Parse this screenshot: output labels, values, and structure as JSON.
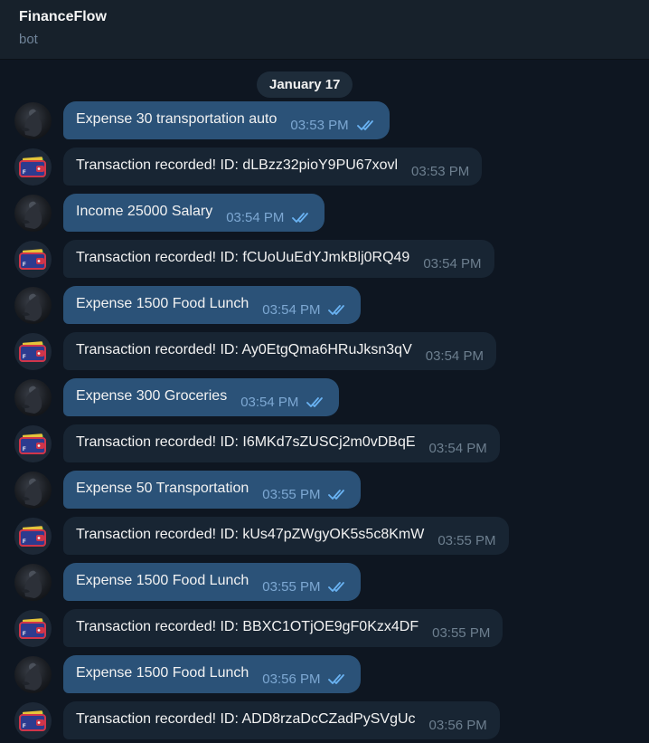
{
  "chat": {
    "title": "FinanceFlow",
    "subtitle": "bot"
  },
  "date_separator": "January 17",
  "icons": {
    "user_avatar": "user-avatar-icon",
    "bot_avatar": "wallet-icon",
    "read_status": "double-check-icon"
  },
  "colors": {
    "outgoing_bubble": "#2b5278",
    "incoming_bubble": "#182533",
    "background": "#0e1621",
    "check_color": "#6ab3f3"
  },
  "messages": [
    {
      "direction": "out",
      "text": "Expense 30 transportation auto",
      "time": "03:53 PM"
    },
    {
      "direction": "in",
      "text": "Transaction recorded! ID: dLBzz32pioY9PU67xovl",
      "time": "03:53 PM"
    },
    {
      "direction": "out",
      "text": "Income 25000 Salary",
      "time": "03:54 PM"
    },
    {
      "direction": "in",
      "text": "Transaction recorded! ID: fCUoUuEdYJmkBlj0RQ49",
      "time": "03:54 PM"
    },
    {
      "direction": "out",
      "text": "Expense 1500 Food Lunch",
      "time": "03:54 PM"
    },
    {
      "direction": "in",
      "text": "Transaction recorded! ID: Ay0EtgQma6HRuJksn3qV",
      "time": "03:54 PM"
    },
    {
      "direction": "out",
      "text": "Expense 300 Groceries",
      "time": "03:54 PM"
    },
    {
      "direction": "in",
      "text": "Transaction recorded! ID: I6MKd7sZUSCj2m0vDBqE",
      "time": "03:54 PM"
    },
    {
      "direction": "out",
      "text": "Expense 50 Transportation",
      "time": "03:55 PM"
    },
    {
      "direction": "in",
      "text": "Transaction recorded! ID: kUs47pZWgyOK5s5c8KmW",
      "time": "03:55 PM"
    },
    {
      "direction": "out",
      "text": "Expense 1500 Food Lunch",
      "time": "03:55 PM"
    },
    {
      "direction": "in",
      "text": "Transaction recorded! ID: BBXC1OTjOE9gF0Kzx4DF",
      "time": "03:55 PM"
    },
    {
      "direction": "out",
      "text": "Expense 1500 Food Lunch",
      "time": "03:56 PM"
    },
    {
      "direction": "in",
      "text": "Transaction recorded! ID: ADD8rzaDcCZadPySVgUc",
      "time": "03:56 PM"
    }
  ]
}
